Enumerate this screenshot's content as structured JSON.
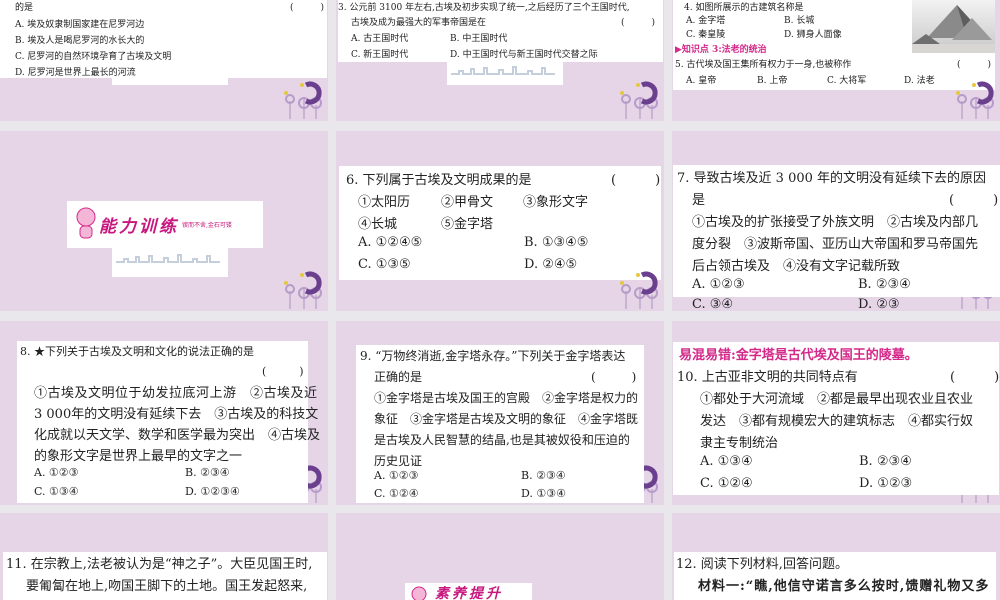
{
  "slides": [
    {
      "lines": [
        "的是",
        "A. 埃及奴隶制国家建在尼罗河边",
        "B. 埃及人是喝尼罗河的水长大的",
        "C. 尼罗河的自然环境孕育了古埃及文明",
        "D. 尼罗河是世界上最长的河流"
      ],
      "paren": "(　　　)"
    },
    {
      "lines": [
        "3. 公元前 3100 年左右,古埃及初步实现了统一,之后经历了三个王国时代,",
        "古埃及成为最强大的军事帝国是在"
      ],
      "opts": [
        "A. 古王国时代",
        "B. 中王国时代",
        "C. 新王国时代",
        "D. 中王国时代与新王国时代交替之际"
      ],
      "paren": "(　　　)"
    },
    {
      "q4": "4. 如图所展示的古建筑名称是",
      "opts": [
        "A. 金字塔",
        "B. 长城",
        "C. 秦皇陵",
        "D. 狮身人面像"
      ],
      "knowledge": "知识点 3:法老的统治",
      "q5": "5. 古代埃及国王集所有权力于一身,也被称作",
      "opts5": [
        "A. 皇帝",
        "B. 上帝",
        "C. 大将军",
        "D. 法老"
      ],
      "paren": "(　　　)"
    },
    {
      "banner_title": "能力训练",
      "banner_sub": "锲而不舍,金石可镂"
    },
    {
      "q": "6. 下列属于古埃及文明成果的是",
      "items": [
        "①太阳历",
        "②甲骨文",
        "③象形文字",
        "④长城",
        "⑤金字塔"
      ],
      "opts": [
        "A. ①②④⑤",
        "B. ①③④⑤",
        "C. ①③⑤",
        "D. ②④⑤"
      ],
      "paren": "(　　　)"
    },
    {
      "lines": [
        "7. 导致古埃及近 3 000 年的文明没有延续下去的原因",
        "是",
        "①古埃及的扩张接受了外族文明　②古埃及内部几",
        "度分裂　③波斯帝国、亚历山大帝国和罗马帝国先",
        "后占领古埃及　④没有文字记载所致"
      ],
      "opts": [
        "A. ①②③",
        "B. ②③④",
        "C. ③④",
        "D. ②③"
      ],
      "paren": "(　　　)"
    },
    {
      "lines": [
        "8. ★下列关于古埃及文明和文化的说法正确的是",
        "①古埃及文明位于幼发拉底河上游　②古埃及近",
        "3 000年的文明没有延续下去　③古埃及的科技文",
        "化成就以天文学、数学和医学最为突出　④古埃及",
        "的象形文字是世界上最早的文字之一"
      ],
      "opts": [
        "A. ①②③",
        "B. ②③④",
        "C. ①③④",
        "D. ①②③④"
      ],
      "paren": "(　　　)"
    },
    {
      "lines": [
        "9. “万物终消逝,金字塔永存。”下列关于金字塔表达",
        "正确的是",
        "①金字塔是古埃及国王的宫殿　②金字塔是权力的",
        "象征　③金字塔是古埃及文明的象征　④金字塔既",
        "是古埃及人民智慧的结晶,也是其被奴役和压迫的",
        "历史见证"
      ],
      "opts": [
        "A. ①②③",
        "B. ②③④",
        "C. ①②④",
        "D. ①③④"
      ],
      "paren": "(　　　)"
    },
    {
      "tip": "易混易错:金字塔是古代埃及国王的陵墓。",
      "lines": [
        "10. 上古亚非文明的共同特点有",
        "①都处于大河流域　②都是最早出现农业且农业",
        "发达　③都有规模宏大的建筑标志　④都实行奴",
        "隶主专制统治"
      ],
      "opts": [
        "A. ①③④",
        "B. ②③④",
        "C. ①②④",
        "D. ①②③"
      ],
      "paren": "(　　　)"
    },
    {
      "lines": [
        "11. 在宗教上,法老被认为是“神之子”。大臣见国王时,",
        "要匍匐在地上,吻国王脚下的土地。国王发起怒来,"
      ]
    },
    {
      "banner_title": "素养提升"
    },
    {
      "lines": [
        "12. 阅读下列材料,回答问题。",
        "材料一:“瞧,他信守诺言多么按时,馈赠礼物又多"
      ]
    }
  ],
  "colors": {
    "slide_bg": "#e5d5e7",
    "accent": "#d4288a"
  }
}
